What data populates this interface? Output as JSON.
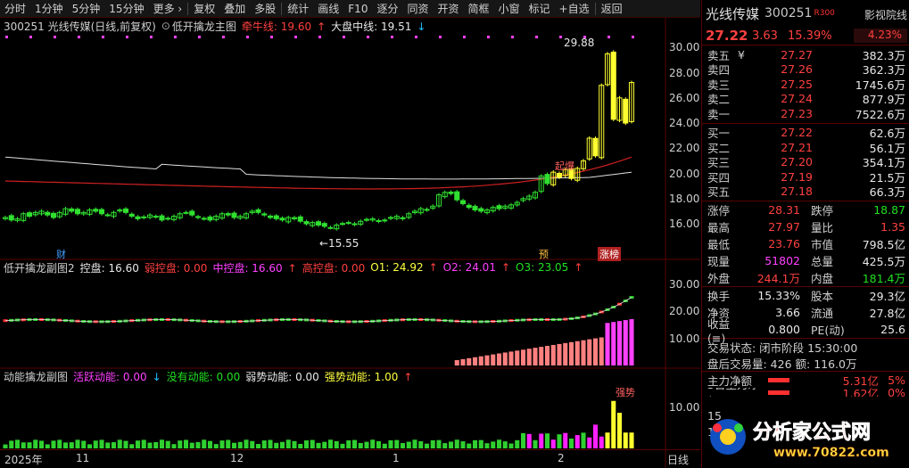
{
  "toolbar": {
    "items": [
      "分时",
      "1分钟",
      "5分钟",
      "15分钟",
      "更多 ›",
      "复权",
      "叠加",
      "多股",
      "统计",
      "画线",
      "F10",
      "逐分",
      "同资",
      "开资",
      "简框",
      "小窗",
      "标记",
      "+自选",
      "返回"
    ]
  },
  "main_pane": {
    "stock": "300251 光线传媒(日线,前复权)",
    "indicator": "低开擒龙主图",
    "param1_label": "牵牛线: 19.60",
    "param1_arrow": "↑",
    "param2_label": "大盘中线: 19.51",
    "param2_arrow": "↓",
    "high_label": "29.88",
    "low_label": "←15.55",
    "marker_cai": "财",
    "marker_yu": "预",
    "marker_zhangbang": "涨榜",
    "marker_qibao": "起爆"
  },
  "sub1": {
    "title": "低开擒龙副图2",
    "kong": "控盘: 16.60",
    "ruo": "弱控盘: 0.00",
    "zhong": "中控盘: 16.60",
    "zhong_arrow": "↑",
    "gao": "高控盘: 0.00",
    "o1": "O1: 24.92",
    "o1_arrow": "↑",
    "o2": "O2: 24.01",
    "o2_arrow": "↑",
    "o3": "O3: 23.05",
    "o3_arrow": "↑",
    "ticks": [
      "30.00",
      "20.00",
      "10.00"
    ]
  },
  "sub2": {
    "title": "动能擒龙副图",
    "active": "活跃动能: 0.00",
    "active_arrow": "↓",
    "none": "没有动能: 0.00",
    "weak": "弱势动能: 0.00",
    "strong": "强势动能: 1.00",
    "strong_arrow": "↑",
    "tick": "10.00",
    "strong_tag": "强势"
  },
  "price_axis": {
    "ticks": [
      "30.00",
      "28.00",
      "26.00",
      "24.00",
      "22.00",
      "20.00",
      "18.00",
      "16.00"
    ]
  },
  "date_axis": {
    "labels": [
      "2025年",
      "11",
      "12",
      "1",
      "2"
    ],
    "right_label": "日线"
  },
  "right_panel": {
    "name": "光线传媒",
    "code": "300251",
    "r_tag": "R",
    "r_num": "300",
    "tab": "影视院线",
    "last": "27.22",
    "change": "3.63",
    "pct": "15.39%",
    "amplitude": "4.23%",
    "yen": "¥",
    "asks": [
      {
        "label": "卖五",
        "price": "27.27",
        "vol": "382.3万"
      },
      {
        "label": "卖四",
        "price": "27.26",
        "vol": "362.3万"
      },
      {
        "label": "卖三",
        "price": "27.25",
        "vol": "1745.6万"
      },
      {
        "label": "卖二",
        "price": "27.24",
        "vol": "877.9万"
      },
      {
        "label": "卖一",
        "price": "27.23",
        "vol": "7522.6万"
      }
    ],
    "bids": [
      {
        "label": "买一",
        "price": "27.22",
        "vol": "62.6万"
      },
      {
        "label": "买二",
        "price": "27.21",
        "vol": "56.1万"
      },
      {
        "label": "买三",
        "price": "27.20",
        "vol": "354.1万"
      },
      {
        "label": "买四",
        "price": "27.19",
        "vol": "21.5万"
      },
      {
        "label": "买五",
        "price": "27.18",
        "vol": "66.3万"
      }
    ],
    "stats": [
      {
        "l1": "涨停",
        "v1": "28.31",
        "c1": "red",
        "l2": "跌停",
        "v2": "18.87",
        "c2": "green"
      },
      {
        "l1": "最高",
        "v1": "27.97",
        "c1": "red",
        "l2": "量比",
        "v2": "1.35",
        "c2": "red"
      },
      {
        "l1": "最低",
        "v1": "23.76",
        "c1": "red",
        "l2": "市值",
        "v2": "798.5亿",
        "c2": "white"
      },
      {
        "l1": "现量",
        "v1": "51802",
        "c1": "mag",
        "l2": "总量",
        "v2": "425.5万",
        "c2": "white"
      },
      {
        "l1": "外盘",
        "v1": "244.1万",
        "c1": "red",
        "l2": "内盘",
        "v2": "181.4万",
        "c2": "green"
      }
    ],
    "stats2": [
      {
        "l1": "换手",
        "v1": "15.33%",
        "c1": "white",
        "l2": "股本",
        "v2": "29.3亿",
        "c2": "white"
      },
      {
        "l1": "净资",
        "v1": "3.66",
        "c1": "white",
        "l2": "流通",
        "v2": "27.8亿",
        "c2": "white"
      },
      {
        "l1": "收益(≡)",
        "v1": "0.800",
        "c1": "white",
        "l2": "PE(动)",
        "v2": "25.6",
        "c2": "white"
      }
    ],
    "trade_state": "交易状态: 闭市阶段 15:30:00",
    "after_hours": "盘后交易量: 426  额: 116.0万",
    "flow1_label": "主力净额",
    "flow1_val": "5.31亿",
    "flow1_pct": "5%",
    "flow2_label": "5日主力净额",
    "flow2_val": "1.62亿",
    "flow2_pct": "0%",
    "row_a": "15",
    "row_b": "15"
  },
  "logo": {
    "text": "分析家公式网",
    "url": "www.70822.com"
  },
  "chart_data": {
    "type": "candlestick",
    "main_ylim": [
      14.8,
      30.8
    ],
    "close_prices": [
      16.5,
      16.3,
      16.4,
      16.8,
      16.6,
      16.9,
      17.0,
      16.7,
      16.5,
      16.9,
      17.2,
      17.0,
      16.8,
      16.9,
      17.1,
      17.0,
      16.8,
      16.7,
      16.9,
      17.1,
      16.9,
      16.6,
      16.4,
      16.5,
      16.7,
      16.6,
      16.3,
      16.4,
      16.6,
      16.8,
      16.9,
      16.7,
      16.5,
      16.4,
      16.3,
      16.6,
      16.8,
      16.7,
      16.5,
      16.6,
      16.8,
      17.0,
      16.9,
      16.7,
      16.5,
      16.4,
      16.3,
      16.5,
      16.4,
      16.2,
      16.0,
      16.1,
      15.9,
      15.8,
      15.7,
      15.9,
      16.0,
      16.1,
      16.0,
      16.2,
      16.3,
      16.4,
      16.2,
      16.3,
      16.5,
      16.6,
      16.4,
      16.8,
      17.0,
      17.2,
      17.1,
      17.4,
      18.3,
      18.5,
      18.4,
      17.9,
      17.6,
      17.3,
      17.1,
      17.0,
      17.1,
      17.3,
      17.2,
      17.4,
      17.5,
      17.7,
      18.0,
      18.2,
      18.5,
      19.8,
      19.2,
      20.1,
      19.7,
      20.3,
      19.6,
      20.4,
      21.0,
      22.8,
      21.4,
      27.0,
      29.5,
      24.3,
      26.0,
      24.0,
      27.22
    ],
    "series": [
      {
        "name": "牵牛线",
        "type": "line"
      },
      {
        "name": "大盘中线",
        "type": "line"
      }
    ],
    "sub1_ylim": [
      0,
      33
    ],
    "sub2_ylim": [
      0,
      16
    ]
  }
}
